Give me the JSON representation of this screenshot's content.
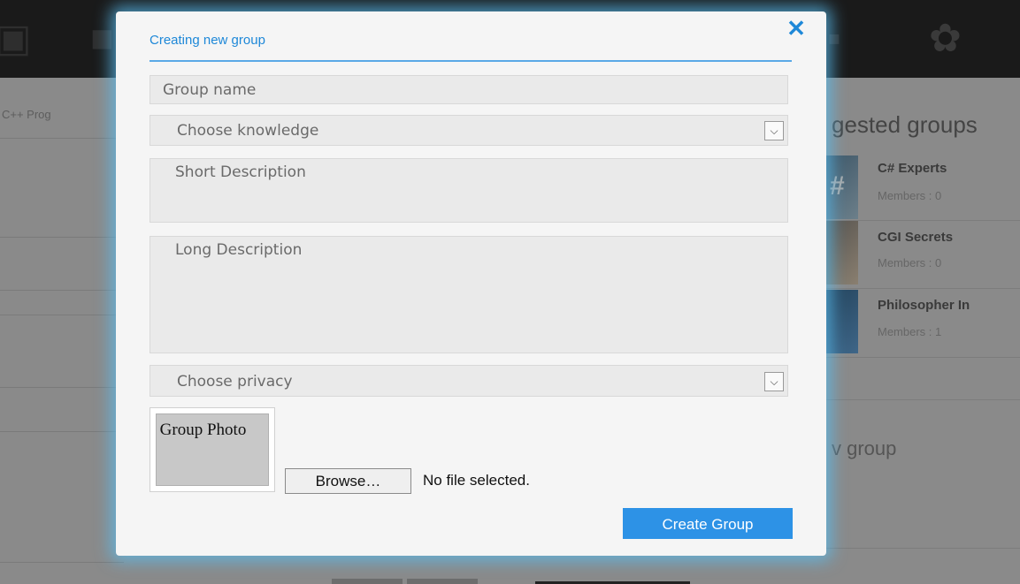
{
  "background": {
    "breadcrumb_fragment": "C++ Prog",
    "suggested_heading": "gested groups",
    "groups": [
      {
        "name": "C# Experts",
        "members": "Members : 0"
      },
      {
        "name": "CGI Secrets",
        "members": "Members : 0"
      },
      {
        "name": "Philosopher In",
        "members": "Members : 1"
      }
    ],
    "new_group_heading": "v group",
    "thumb_glyph": "#"
  },
  "modal": {
    "title": "Creating new group",
    "close_label": "✕",
    "group_name_placeholder": "Group name",
    "knowledge_placeholder": "Choose knowledge",
    "short_description_placeholder": "Short Description",
    "long_description_placeholder": "Long Description",
    "privacy_placeholder": "Choose privacy",
    "group_photo_label": "Group Photo",
    "browse_label": "Browse…",
    "file_status": "No file selected.",
    "create_button_label": "Create Group"
  },
  "icons": {
    "dropdown": "chevron-down-icon",
    "close": "close-icon"
  },
  "colors": {
    "accent": "#1e88d8",
    "button": "#2d92e6",
    "glow": "#5abef0"
  }
}
